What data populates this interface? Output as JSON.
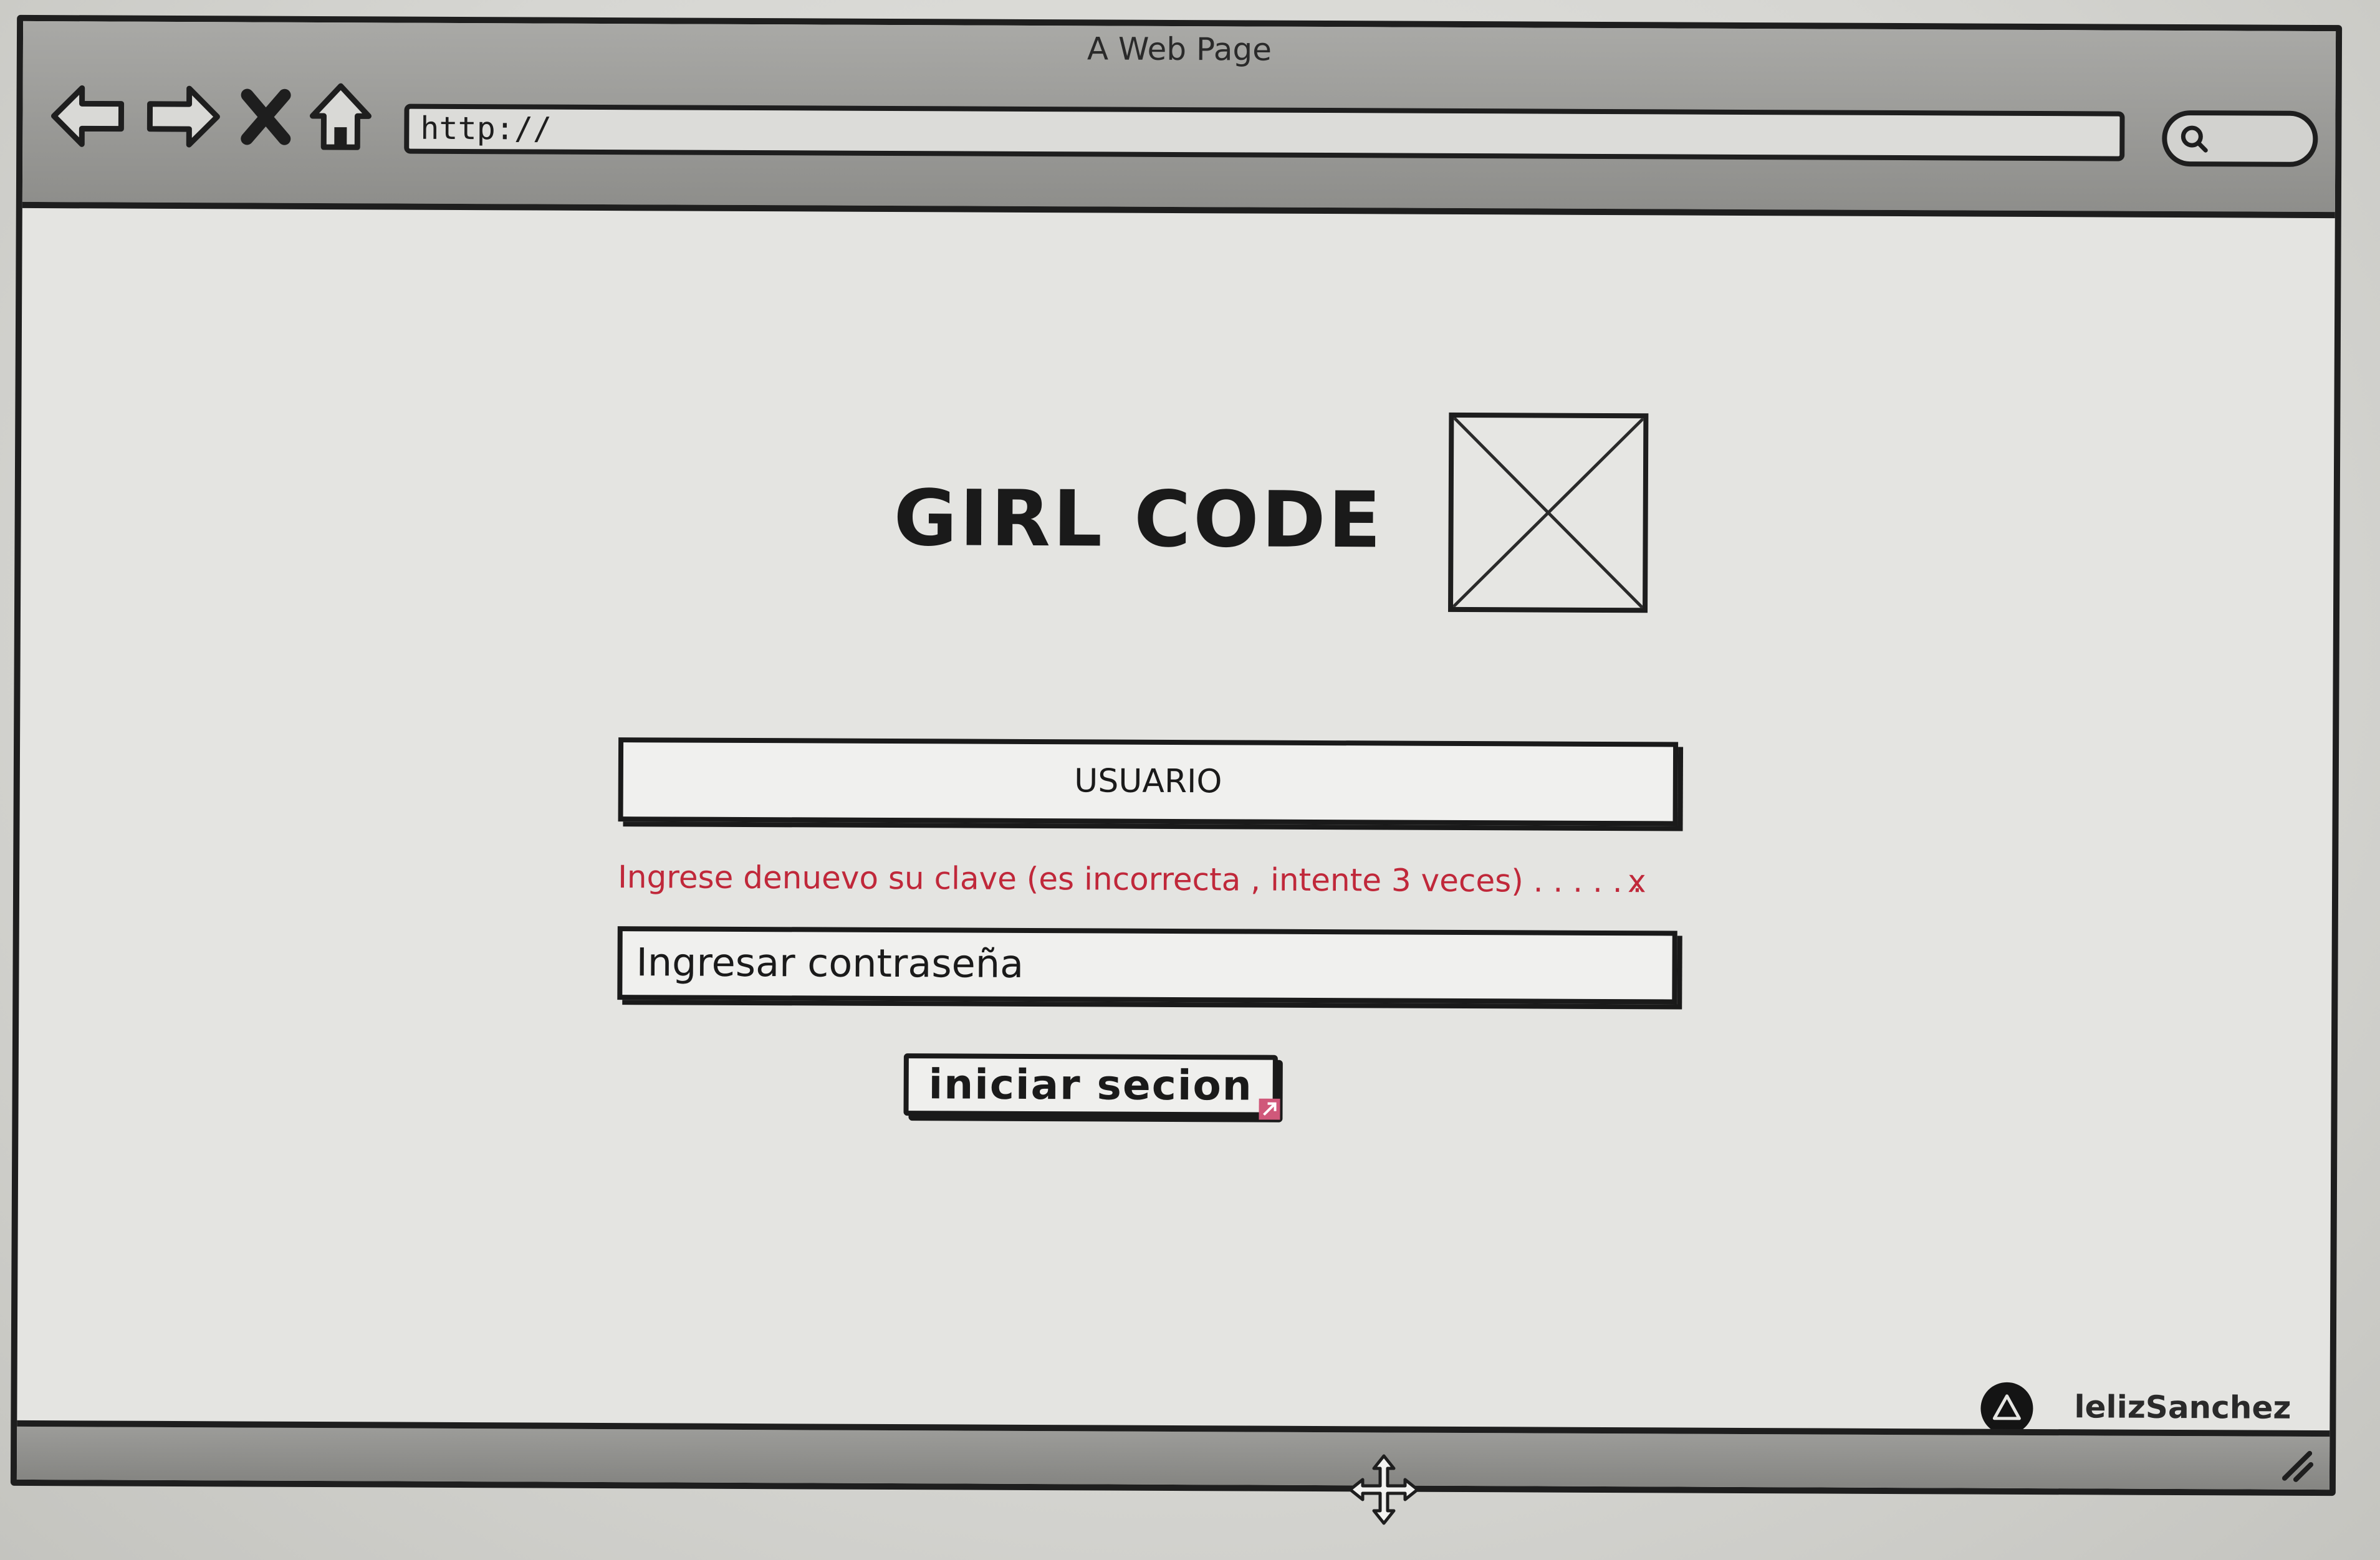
{
  "window": {
    "title": "A Web Page"
  },
  "toolbar": {
    "back_icon": "back-arrow-icon",
    "forward_icon": "forward-arrow-icon",
    "stop_icon": "stop-x-icon",
    "home_icon": "home-icon",
    "address_value": "http://",
    "search_icon": "search-icon"
  },
  "page": {
    "brand_title": "GIRL CODE",
    "logo_icon": "image-placeholder-icon",
    "username_label": "USUARIO",
    "error_message": "Ingrese denuevo su clave (es incorrecta , intente 3 veces) . . . . . .",
    "error_close": "x",
    "password_placeholder": "Ingresar contraseña",
    "login_button": "iniciar secion",
    "error_color": "#c0283a"
  },
  "footer": {
    "avatar_icon": "user-avatar-icon",
    "username": "lelizSanchez"
  },
  "statusbar": {
    "resize_icon": "resize-grip-icon"
  }
}
